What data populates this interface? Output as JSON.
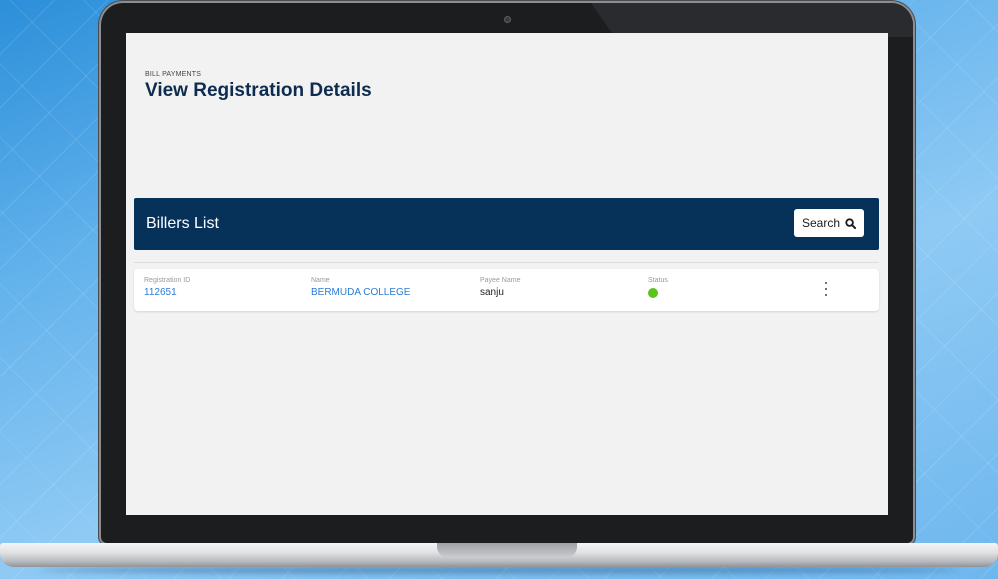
{
  "header": {
    "breadcrumb": "BILL PAYMENTS",
    "title": "View Registration Details"
  },
  "billers": {
    "title": "Billers List",
    "search_label": "Search",
    "search_icon": "search-icon"
  },
  "table": {
    "columns": [
      "Registration ID",
      "Name",
      "Payee Name",
      "Status"
    ],
    "rows": [
      {
        "registration_id": "112651",
        "name": "BERMUDA COLLEGE",
        "payee_name": "sanju",
        "status_color": "#5bc21e"
      }
    ],
    "more_icon": "more-vertical-icon"
  },
  "colors": {
    "header_bar": "#063159",
    "link": "#2b7bd6",
    "status_active": "#5bc21e"
  }
}
